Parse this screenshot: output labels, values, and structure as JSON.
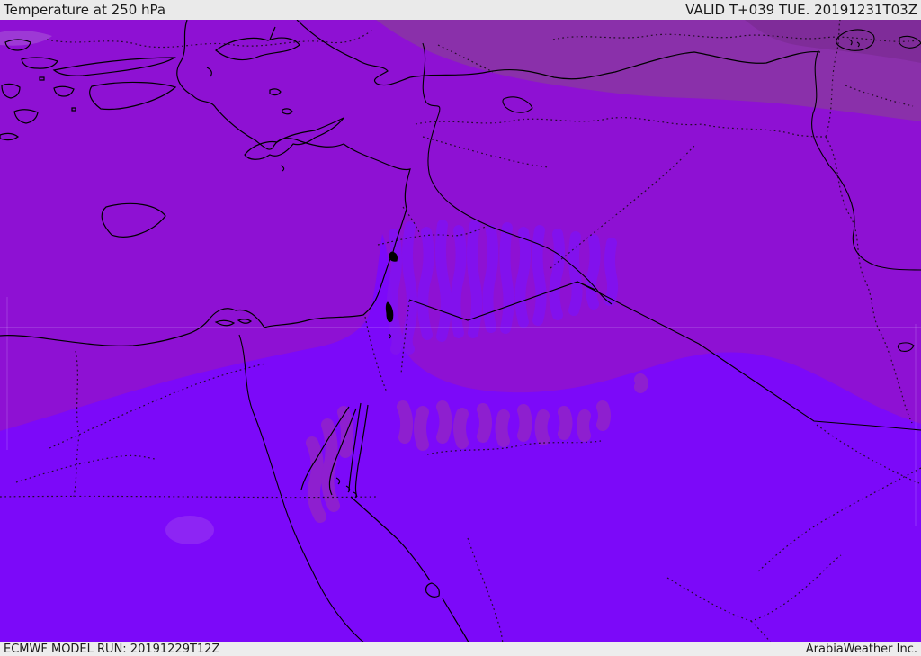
{
  "header": {
    "title": "Temperature at 250 hPa",
    "validity": "VALID T+039 TUE. 20191231T03Z"
  },
  "footer": {
    "model_run": "ECMWF MODEL RUN: 20191229T12Z",
    "credit": "ArabiaWeather Inc."
  },
  "map": {
    "colors": {
      "band_medium": "#8e11d3",
      "band_muted": "#8a30aa",
      "band_corner": "#7d2c97",
      "band_bright": "#7c09f9",
      "stripe_bright": "#8212ef",
      "blob_medium": "#9021cd",
      "patch_light": "#b06ad8",
      "patch_soft": "#9a3cf0",
      "coastline": "#000000",
      "border": "#1a0a1a",
      "gridline": "#e2c8ff",
      "bar_background": "#eaeaea",
      "bar_text": "#1a1a1a"
    }
  }
}
